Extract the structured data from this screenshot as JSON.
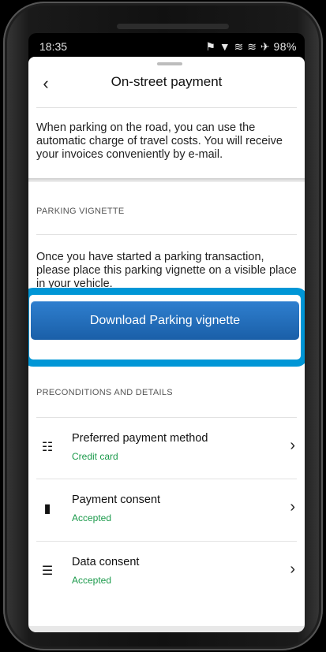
{
  "status": {
    "time": "18:35",
    "icons": "⚑ ▼ ≋ ≋ ✈ 98%"
  },
  "header": {
    "back_icon": "chevron-left-icon",
    "title": "On-street payment"
  },
  "intro": "When parking on the road, you can use the automatic charge of travel costs. You will receive your invoices conveniently by e-mail.",
  "vignette": {
    "section_label": "PARKING VIGNETTE",
    "text": "Once you have started a parking transaction, please place this parking vignette on a visible place in your vehicle.",
    "button_label": "Download Parking vignette"
  },
  "details": {
    "section_label": "PRECONDITIONS AND DETAILS",
    "rows": [
      {
        "icon": "contactless-payment-icon",
        "label": "Preferred payment method",
        "sub": "Credit card"
      },
      {
        "icon": "card-check-icon",
        "label": "Payment consent",
        "sub": "Accepted"
      },
      {
        "icon": "list-check-icon",
        "label": "Data consent",
        "sub": "Accepted"
      }
    ]
  },
  "colors": {
    "accent": "#0096d6",
    "button": "#1f6bb8",
    "status_green": "#1b9a4b"
  }
}
